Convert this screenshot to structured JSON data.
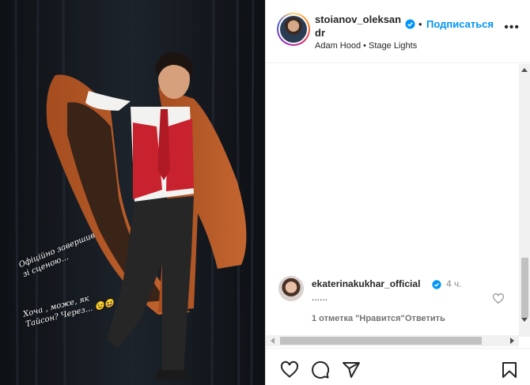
{
  "header": {
    "username": "stoianov_oleksandr",
    "dot": "•",
    "follow_label": "Подписаться",
    "audio": "Adam Hood • Stage Lights",
    "more": "•••"
  },
  "photo": {
    "caption_1": "Офіційно завершив зі сценою...",
    "caption_2": "Хоча , може, як Тайсон? Через... 😉😆"
  },
  "comment": {
    "username": "ekaterinakukhar_official",
    "time": "4 ч.",
    "text": "......",
    "likes": "1 отметка \"Нравится\"",
    "reply_label": "Ответить"
  },
  "actions": [
    "heart-icon",
    "comment-icon",
    "share-icon",
    "bookmark-icon"
  ],
  "colors": {
    "accent": "#0095f6",
    "coat": "#b45a2a",
    "vest": "#c8222e",
    "text": "#262626"
  }
}
